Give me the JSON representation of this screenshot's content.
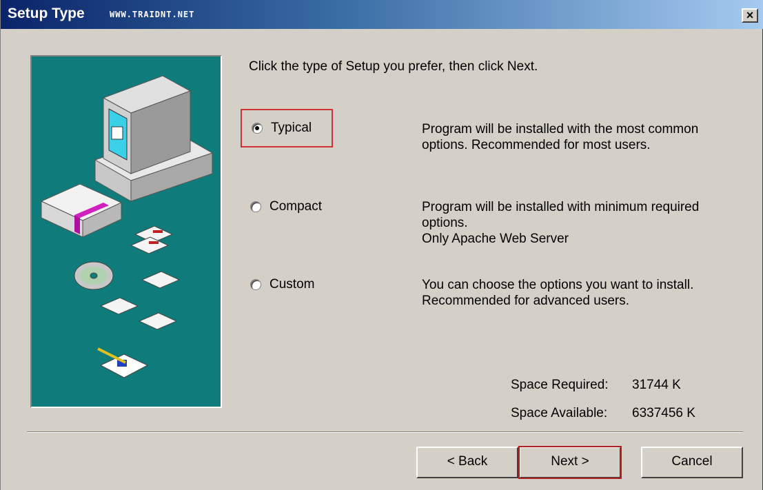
{
  "window": {
    "title": "Setup Type",
    "subtitle": "WWW.TRAIDNT.NET",
    "close_label": "×"
  },
  "instruction": "Click the type of Setup you prefer, then click Next.",
  "options": [
    {
      "label": "Typical",
      "selected": true,
      "desc": [
        "Program will be installed with the most common",
        "options. Recommended for most users."
      ]
    },
    {
      "label": "Compact",
      "selected": false,
      "desc": [
        "Program will be installed with minimum required",
        "options.",
        "Only Apache Web Server"
      ]
    },
    {
      "label": "Custom",
      "selected": false,
      "desc": [
        "You can choose the options you want to install.",
        "Recommended for advanced users."
      ]
    }
  ],
  "space": {
    "required_label": "Space Required:",
    "required_value": "31744 K",
    "available_label": "Space Available:",
    "available_value": "6337456 K"
  },
  "buttons": {
    "back": "< Back",
    "next": "Next >",
    "cancel": "Cancel"
  },
  "colors": {
    "titlebar_start": "#0a246a",
    "art_background": "#0f7b7b",
    "dialog_background": "#d4d0c8",
    "focus_border": "#d03030"
  }
}
